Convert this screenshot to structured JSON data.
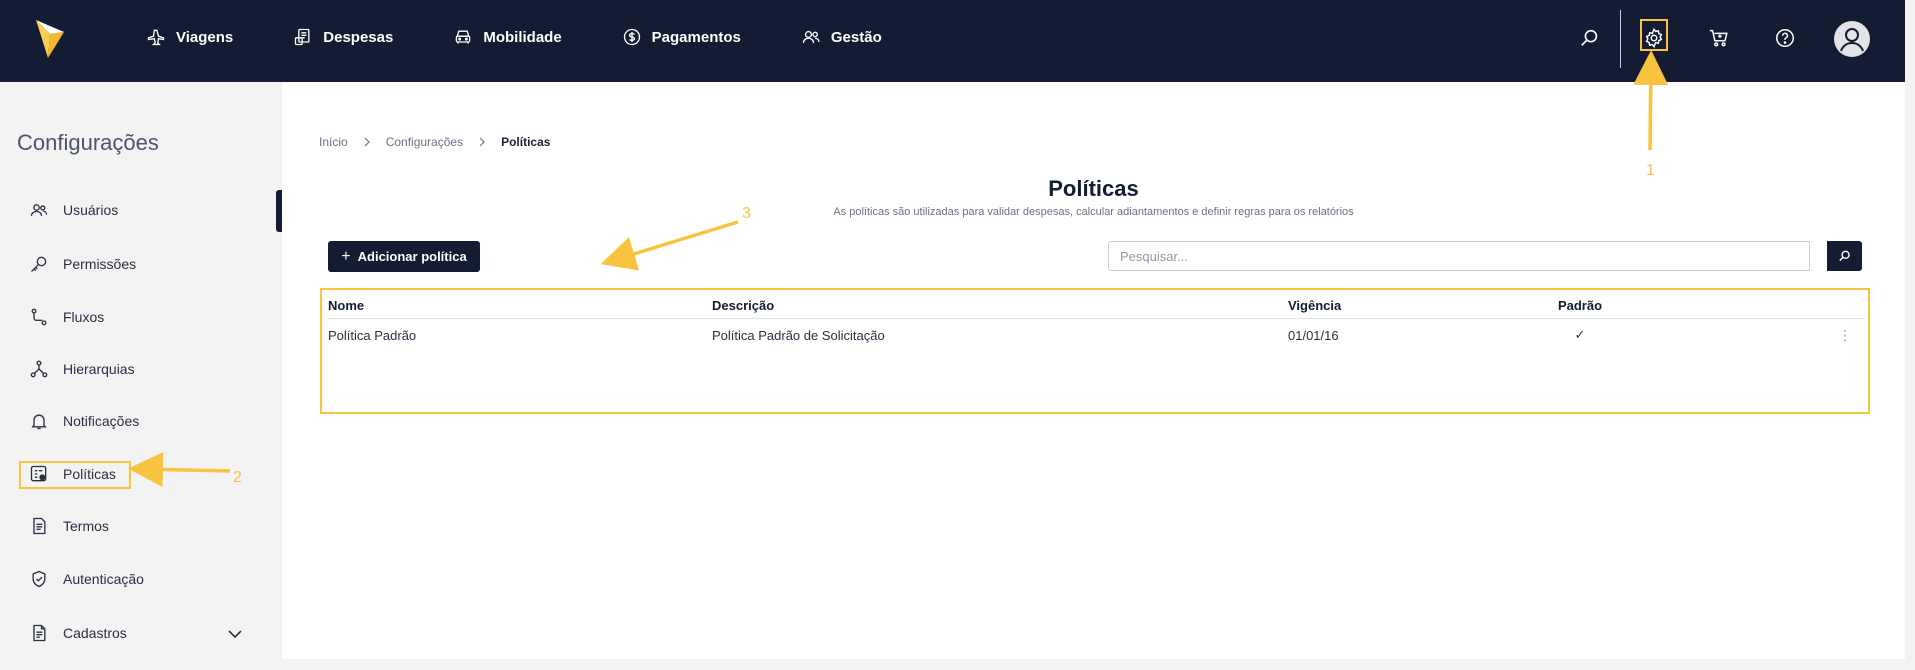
{
  "nav": {
    "items": [
      {
        "label": "Viagens",
        "icon": "airplane-icon"
      },
      {
        "label": "Despesas",
        "icon": "receipt-icon"
      },
      {
        "label": "Mobilidade",
        "icon": "car-icon"
      },
      {
        "label": "Pagamentos",
        "icon": "dollar-icon"
      },
      {
        "label": "Gestão",
        "icon": "people-icon"
      }
    ]
  },
  "sidebar": {
    "title": "Configurações",
    "items": [
      {
        "label": "Usuários",
        "icon": "users-icon"
      },
      {
        "label": "Permissões",
        "icon": "key-icon"
      },
      {
        "label": "Fluxos",
        "icon": "flow-icon"
      },
      {
        "label": "Hierarquias",
        "icon": "hierarchy-icon"
      },
      {
        "label": "Notificações",
        "icon": "bell-icon"
      },
      {
        "label": "Políticas",
        "icon": "policy-icon"
      },
      {
        "label": "Termos",
        "icon": "document-icon"
      },
      {
        "label": "Autenticação",
        "icon": "shield-icon"
      },
      {
        "label": "Cadastros",
        "icon": "file-icon"
      }
    ]
  },
  "breadcrumb": {
    "items": [
      "Início",
      "Configurações",
      "Políticas"
    ]
  },
  "page": {
    "title": "Políticas",
    "subtitle": "As políticas são utilizadas para validar despesas, calcular adiantamentos e definir regras para os relatórios",
    "add_label": "Adicionar política",
    "search_placeholder": "Pesquisar..."
  },
  "table": {
    "headers": [
      "Nome",
      "Descrição",
      "Vigência",
      "Padrão"
    ],
    "rows": [
      {
        "nome": "Política Padrão",
        "descricao": "Política Padrão de Solicitação",
        "vigencia": "01/01/16",
        "padrao": "✓",
        "menu": "⋮"
      }
    ]
  },
  "annotations": [
    "1",
    "2",
    "3"
  ],
  "colors": {
    "navy": "#141c33",
    "accent": "#f8c440",
    "logo": "#f5b82e"
  }
}
